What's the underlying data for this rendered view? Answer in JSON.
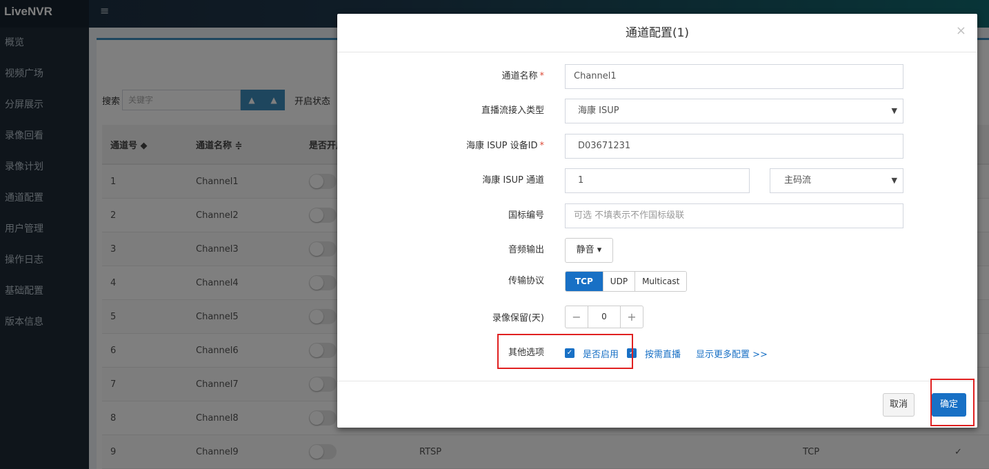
{
  "app": {
    "logo": "LiveNVR",
    "menu_icon": "≡"
  },
  "sidebar": {
    "items": [
      {
        "label": "概览"
      },
      {
        "label": "视频广场"
      },
      {
        "label": "分屏展示"
      },
      {
        "label": "录像回看"
      },
      {
        "label": "录像计划"
      },
      {
        "label": "通道配置"
      },
      {
        "label": "用户管理"
      },
      {
        "label": "操作日志"
      },
      {
        "label": "基础配置"
      },
      {
        "label": "版本信息"
      }
    ]
  },
  "toolbar": {
    "search_label": "搜索",
    "search_placeholder": "关键字",
    "state_label": "开启状态"
  },
  "table": {
    "headers": [
      "通道号 ◆",
      "通道名称 ≑",
      "是否开启"
    ],
    "rows": [
      {
        "id": "1",
        "name": "Channel1",
        "proto": "",
        "transport": "",
        "flag": ""
      },
      {
        "id": "2",
        "name": "Channel2",
        "proto": "",
        "transport": "",
        "flag": ""
      },
      {
        "id": "3",
        "name": "Channel3",
        "proto": "",
        "transport": "",
        "flag": ""
      },
      {
        "id": "4",
        "name": "Channel4",
        "proto": "",
        "transport": "",
        "flag": ""
      },
      {
        "id": "5",
        "name": "Channel5",
        "proto": "",
        "transport": "",
        "flag": ""
      },
      {
        "id": "6",
        "name": "Channel6",
        "proto": "",
        "transport": "",
        "flag": ""
      },
      {
        "id": "7",
        "name": "Channel7",
        "proto": "",
        "transport": "",
        "flag": ""
      },
      {
        "id": "8",
        "name": "Channel8",
        "proto": "",
        "transport": "",
        "flag": ""
      },
      {
        "id": "9",
        "name": "Channel9",
        "proto": "RTSP",
        "transport": "TCP",
        "flag": "✓"
      }
    ]
  },
  "modal": {
    "title": "通道配置(1)",
    "close": "×",
    "fields": {
      "name_label": "通道名称",
      "name_value": "Channel1",
      "stream_type_label": "直播流接入类型",
      "stream_type_value": "海康 ISUP",
      "device_id_label": "海康 ISUP 设备ID",
      "device_id_value": "D03671231",
      "channel_label": "海康 ISUP 通道",
      "channel_value": "1",
      "stream_select_value": "主码流",
      "gb_label": "国标编号",
      "gb_placeholder": "可选 不填表示不作国标级联",
      "audio_label": "音频输出",
      "audio_value": "静音 ▾",
      "transport_label": "传输协议",
      "transport_options": [
        "TCP",
        "UDP",
        "Multicast"
      ],
      "retention_label": "录像保留(天)",
      "retention_value": "0",
      "minus": "−",
      "plus": "+",
      "other_label": "其他选项",
      "enable_label": "是否启用",
      "ondemand_label": "按需直播",
      "more_link": "显示更多配置 >>"
    },
    "cancel_label": "取消",
    "ok_label": "确定"
  },
  "colors": {
    "primary": "#1870c5",
    "highlight": "#e02020"
  }
}
